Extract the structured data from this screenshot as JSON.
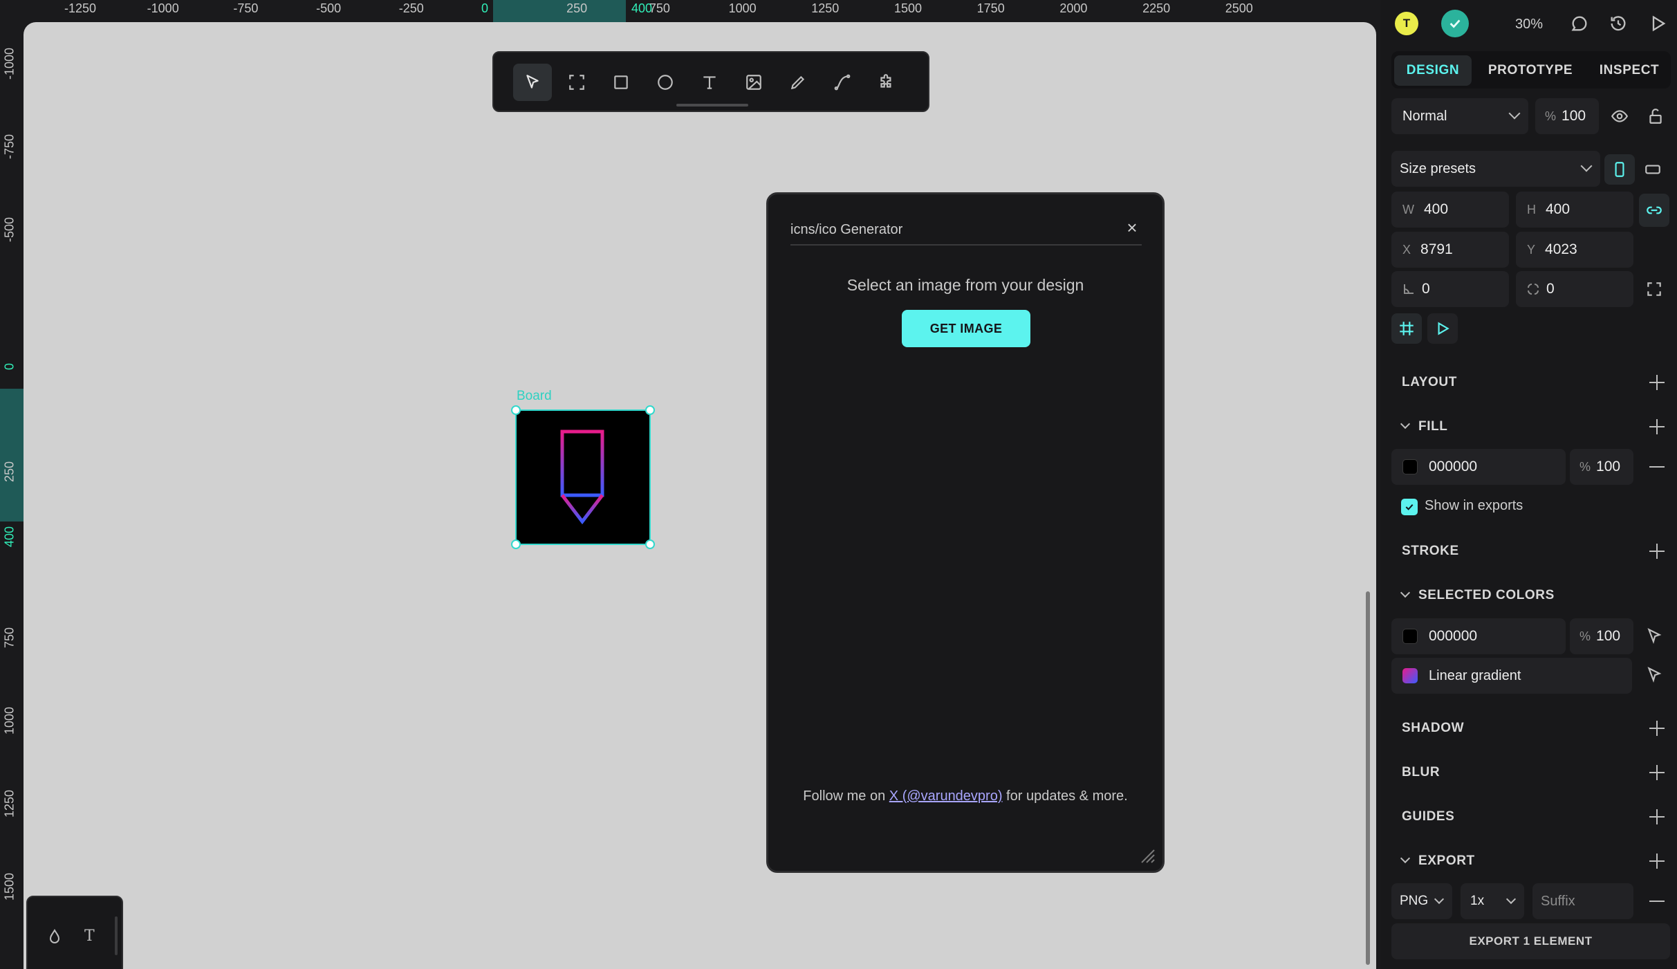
{
  "rulers": {
    "top_ticks": [
      {
        "label": "-1250",
        "accent": false
      },
      {
        "label": "-1000",
        "accent": false
      },
      {
        "label": "-750",
        "accent": false
      },
      {
        "label": "-500",
        "accent": false
      },
      {
        "label": "-250",
        "accent": false
      },
      {
        "label": "0",
        "accent": true
      },
      {
        "label": "250",
        "accent": false
      },
      {
        "label": "400",
        "accent": true
      },
      {
        "label": "750",
        "accent": false
      },
      {
        "label": "1000",
        "accent": false
      },
      {
        "label": "1250",
        "accent": false
      },
      {
        "label": "1500",
        "accent": false
      },
      {
        "label": "1750",
        "accent": false
      },
      {
        "label": "2000",
        "accent": false
      },
      {
        "label": "2250",
        "accent": false
      },
      {
        "label": "2500",
        "accent": false
      }
    ],
    "left_ticks": [
      {
        "label": "-1000",
        "accent": false
      },
      {
        "label": "-750",
        "accent": false
      },
      {
        "label": "-500",
        "accent": false
      },
      {
        "label": "0",
        "accent": true
      },
      {
        "label": "250",
        "accent": false
      },
      {
        "label": "400",
        "accent": true
      },
      {
        "label": "750",
        "accent": false
      },
      {
        "label": "1000",
        "accent": false
      },
      {
        "label": "1250",
        "accent": false
      },
      {
        "label": "1500",
        "accent": false
      }
    ]
  },
  "toolbar": {
    "tools": [
      {
        "name": "move-tool",
        "icon": "cursor-arrow-icon",
        "active": true
      },
      {
        "name": "board-tool",
        "icon": "board-frame-icon",
        "active": false
      },
      {
        "name": "rectangle-tool",
        "icon": "rectangle-icon",
        "active": false
      },
      {
        "name": "ellipse-tool",
        "icon": "ellipse-icon",
        "active": false
      },
      {
        "name": "text-tool",
        "icon": "text-icon",
        "active": false
      },
      {
        "name": "image-tool",
        "icon": "image-icon",
        "active": false
      },
      {
        "name": "pencil-tool",
        "icon": "pencil-icon",
        "active": false
      },
      {
        "name": "path-tool",
        "icon": "path-curve-icon",
        "active": false
      },
      {
        "name": "plugins-tool",
        "icon": "puzzle-icon",
        "active": false
      }
    ]
  },
  "canvas": {
    "board_label": "Board",
    "board_fill": "#000000",
    "logo_gradient": [
      "#e81c8a",
      "#3b5bff"
    ]
  },
  "plugin": {
    "title": "icns/ico Generator",
    "close_symbol": "×",
    "message": "Select an image from your design",
    "button_label": "GET IMAGE",
    "footer_prefix": "Follow me on ",
    "footer_link": "X (@varundevpro)",
    "footer_suffix": " for updates & more."
  },
  "mini_panel": {
    "items": [
      "drop-icon",
      "text-icon"
    ],
    "text_glyph": "T"
  },
  "header": {
    "avatar_initial": "T",
    "avatar_color": "#e9ec4a",
    "status_color": "#2bb39c",
    "zoom": "30%"
  },
  "tabs": [
    {
      "label": "DESIGN",
      "active": true
    },
    {
      "label": "PROTOTYPE",
      "active": false
    },
    {
      "label": "INSPECT",
      "active": false
    }
  ],
  "layer": {
    "blend_mode": "Normal",
    "opacity_symbol": "%",
    "opacity": "100"
  },
  "measures": {
    "size_presets": "Size presets",
    "w_label": "W",
    "w": "400",
    "h_label": "H",
    "h": "400",
    "x_label": "X",
    "x": "8791",
    "y_label": "Y",
    "y": "4023",
    "rotation": "0",
    "radius": "0"
  },
  "sections": {
    "layout": "LAYOUT",
    "fill": "FILL",
    "stroke": "STROKE",
    "selected_colors": "SELECTED COLORS",
    "shadow": "SHADOW",
    "blur": "BLUR",
    "guides": "GUIDES",
    "export": "EXPORT"
  },
  "fill": {
    "hex": "000000",
    "opacity_symbol": "%",
    "opacity": "100",
    "swatch": "#000000",
    "show_in_exports": "Show in exports"
  },
  "selected_colors": [
    {
      "hex": "000000",
      "opacity": "100",
      "swatch": "#000000"
    },
    {
      "label": "Linear gradient"
    }
  ],
  "export": {
    "format": "PNG",
    "scale": "1x",
    "suffix_placeholder": "Suffix",
    "button_label": "EXPORT 1 ELEMENT"
  },
  "colors": {
    "accent": "#5cf3ee",
    "panel_bg": "#18181a",
    "canvas_bg": "#d1d1d1"
  }
}
